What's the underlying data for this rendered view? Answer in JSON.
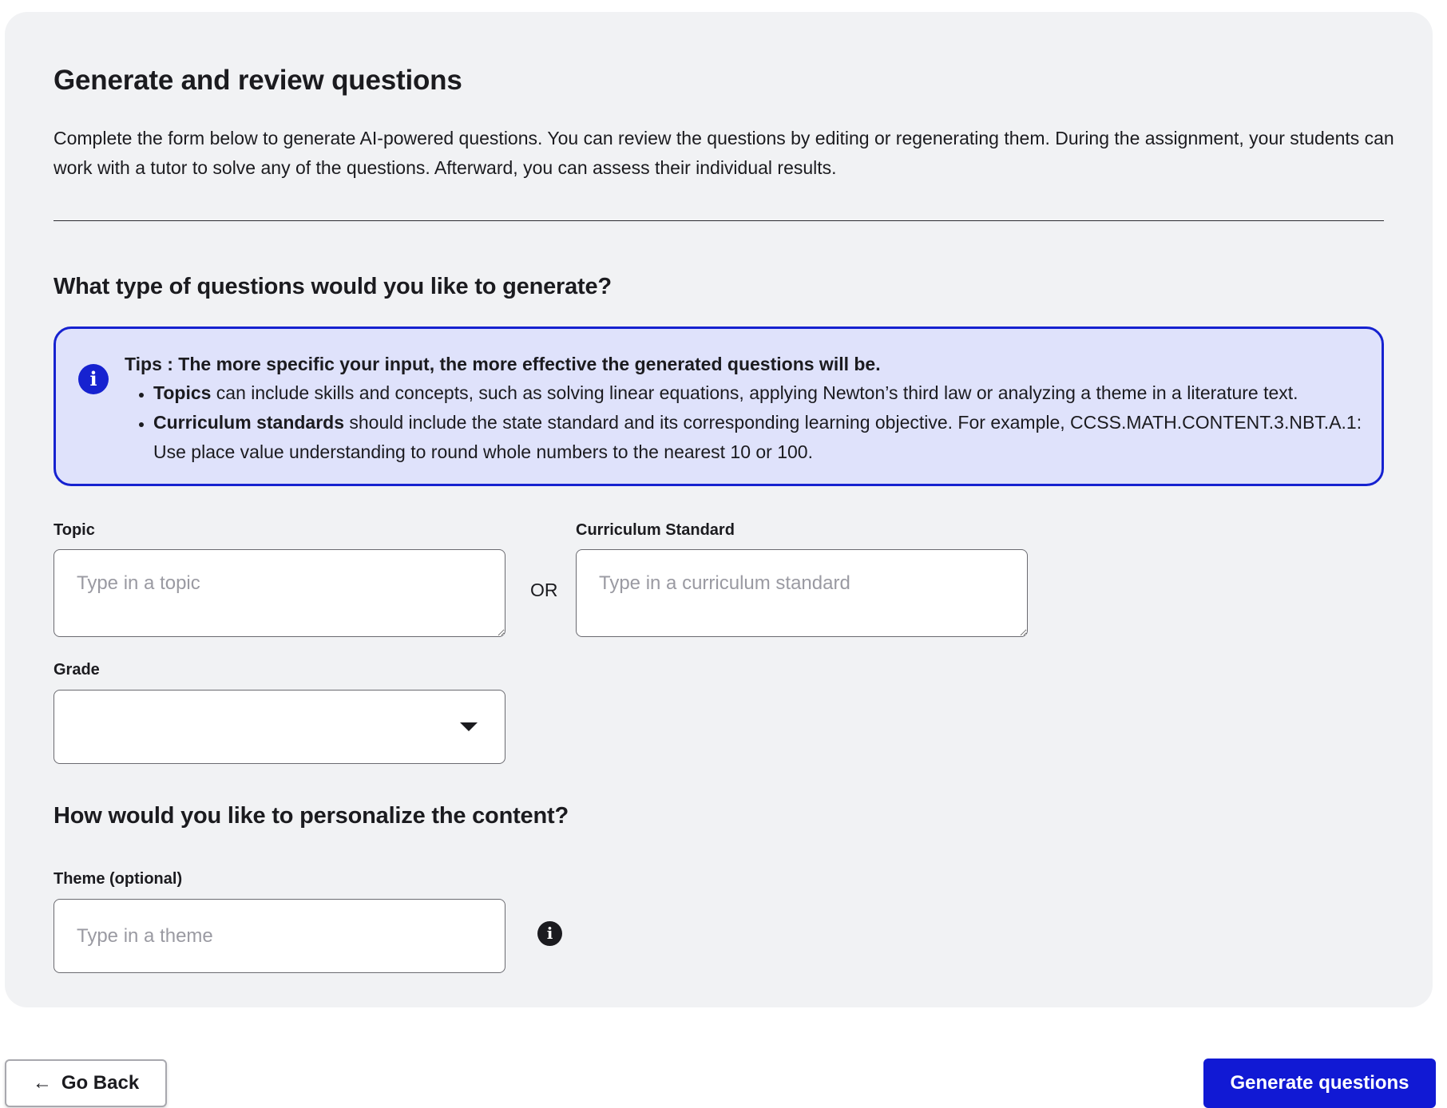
{
  "page": {
    "title": "Generate and review questions",
    "intro": "Complete the form below to generate AI-powered questions. You can review the questions by editing or regenerating them. During the assignment, your students can work with a tutor to solve any of the questions. Afterward, you can assess their individual results."
  },
  "question_type": {
    "heading": "What type of questions would you like to generate?",
    "tips": {
      "icon": "info-icon",
      "heading": "Tips : The more specific your input, the more effective the generated questions will be.",
      "items": [
        {
          "bold": "Topics",
          "text": " can include skills and concepts, such as solving linear equations, applying Newton’s third law or analyzing a theme in a literature text."
        },
        {
          "bold": "Curriculum standards",
          "text": " should include the state standard and its corresponding learning objective. For example, CCSS.MATH.CONTENT.3.NBT.A.1: Use place value understanding to round whole numbers to the nearest 10 or 100."
        }
      ]
    },
    "topic": {
      "label": "Topic",
      "placeholder": "Type in a topic",
      "value": ""
    },
    "or_label": "OR",
    "curriculum": {
      "label": "Curriculum Standard",
      "placeholder": "Type in a curriculum standard",
      "value": ""
    },
    "grade": {
      "label": "Grade",
      "selected": "",
      "icon": "chevron-down-icon"
    }
  },
  "personalize": {
    "heading": "How would you like to personalize the content?",
    "theme": {
      "label": "Theme (optional)",
      "placeholder": "Type in a theme",
      "value": "",
      "icon": "info-icon"
    }
  },
  "footer": {
    "back_arrow": "←",
    "back_label": "Go Back",
    "generate_label": "Generate questions"
  },
  "colors": {
    "accent": "#1119d4",
    "tips_background": "#dfe2fb",
    "card_background": "#f1f2f4"
  }
}
